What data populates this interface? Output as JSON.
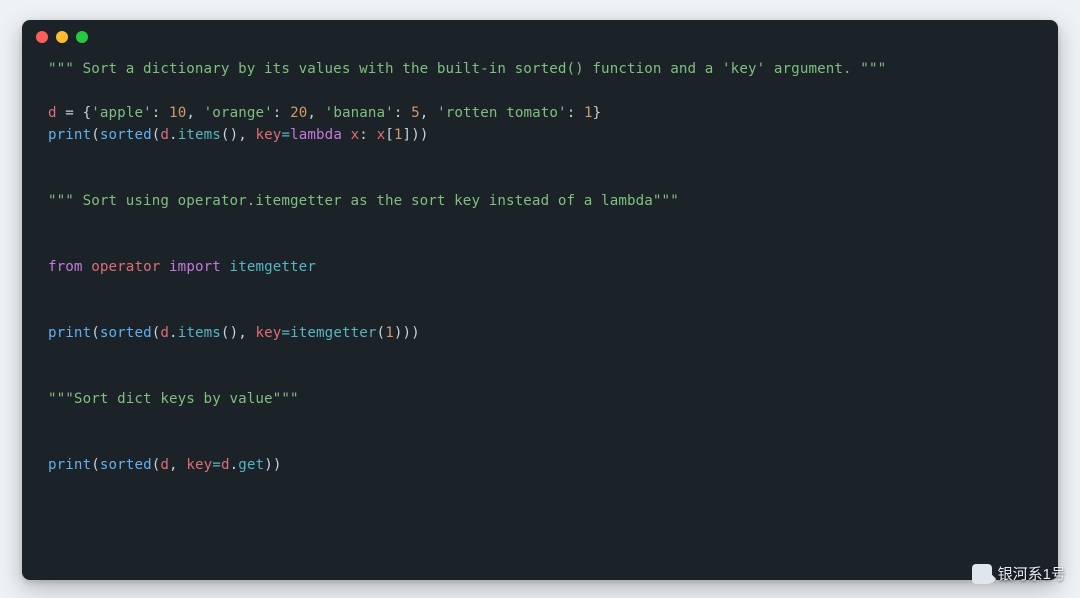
{
  "colors": {
    "page_bg": "#eef2f5",
    "window_bg": "#1b2228",
    "string": "#7fbf7f",
    "number": "#d19a66",
    "keyword": "#c678dd",
    "function": "#61afef",
    "callable": "#56b6c2",
    "variable": "#e06c75",
    "plain": "#c8d1d9",
    "dot_red": "#ff5f56",
    "dot_yellow": "#ffbd2e",
    "dot_green": "#27c93f"
  },
  "watermark": "银河系1号",
  "code": {
    "c1": "\"\"\" Sort a dictionary by its values with the built-in sorted() function and a 'key' argument. \"\"\"",
    "l2_d": "d",
    "l2_eq": " = ",
    "l2_ob": "{",
    "l2_k1": "'apple'",
    "l2_col": ": ",
    "l2_v1": "10",
    "l2_com": ", ",
    "l2_k2": "'orange'",
    "l2_v2": "20",
    "l2_k3": "'banana'",
    "l2_v3": "5",
    "l2_k4": "'rotten tomato'",
    "l2_v4": "1",
    "l2_cb": "}",
    "l3_print": "print",
    "l3_op": "(",
    "l3_sorted": "sorted",
    "l3_d": "d",
    "l3_dot": ".",
    "l3_items": "items",
    "l3_paren": "()",
    "l3_comma": ", ",
    "l3_key": "key",
    "l3_eq": "=",
    "l3_lambda": "lambda",
    "l3_sp": " ",
    "l3_x": "x",
    "l3_colon": ": ",
    "l3_x2": "x",
    "l3_lb": "[",
    "l3_one": "1",
    "l3_rb": "]",
    "l3_cp": "))",
    "c2": "\"\"\" Sort using operator.itemgetter as the sort key instead of a lambda\"\"\"",
    "l5_from": "from",
    "l5_mod": "operator",
    "l5_import": "import",
    "l5_name": "itemgetter",
    "l6_print": "print",
    "l6_sorted": "sorted",
    "l6_d": "d",
    "l6_items": "items",
    "l6_key": "key",
    "l6_ig": "itemgetter",
    "l6_one": "1",
    "l6_cp": ")))",
    "c3": "\"\"\"Sort dict keys by value\"\"\"",
    "l8_print": "print",
    "l8_sorted": "sorted",
    "l8_d": "d",
    "l8_key": "key",
    "l8_d2": "d",
    "l8_get": "get",
    "l8_cp": "))"
  }
}
